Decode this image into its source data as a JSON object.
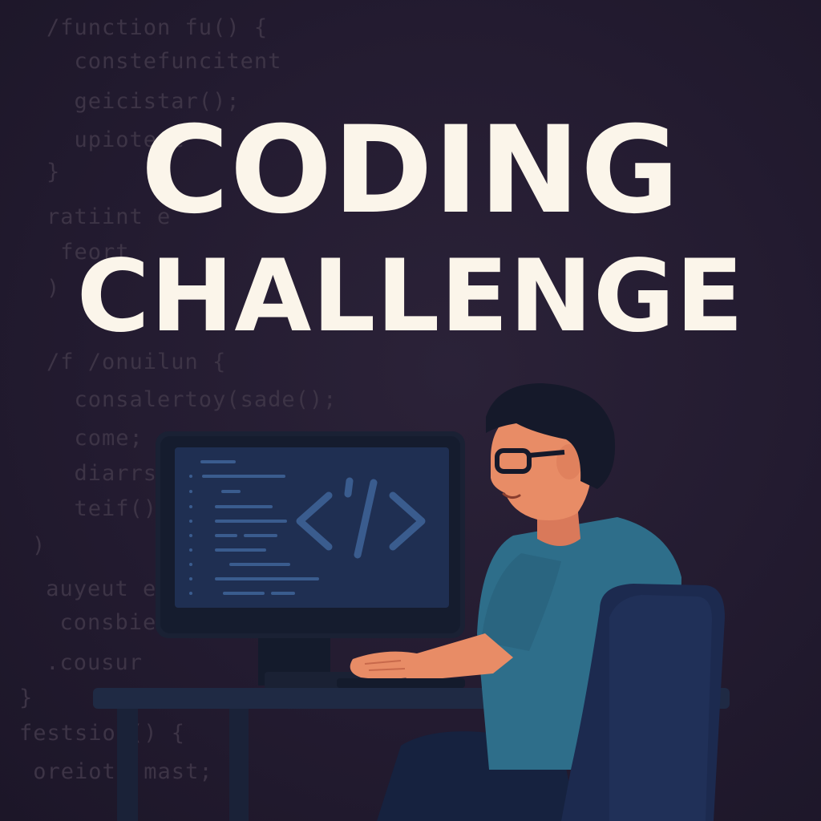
{
  "title": {
    "line1": "CODING",
    "line2": "CHALLENGE"
  },
  "background_code": [
    "/function fu() {",
    "  constefuncitent",
    "  geicistar();",
    "  upiote c",
    "}",
    "ratiint e",
    " feort",
    ")",
    "/f /onuilun {",
    "  consalertoy(sade();",
    "  come;",
    "  diarrs;",
    "  teif().",
    ")",
    " auyeut e;",
    "  consbie.id",
    " .cousur",
    "}",
    "festsion() {",
    " oreiot  mast;"
  ],
  "monitor": {
    "code_symbol": "</>",
    "code_symbol_icon": "code-brackets-icon"
  },
  "colors": {
    "background": "#231b30",
    "title_text": "#fbf5ea",
    "faint_code": "#3d3446",
    "monitor_frame": "#1a2134",
    "monitor_screen": "#1f2f52",
    "screen_code": "#3a5c8e",
    "shirt": "#2e6e8a",
    "skin": "#e88c66",
    "hair": "#15192a",
    "chair": "#1c2a4f",
    "desk": "#1f2a44"
  }
}
